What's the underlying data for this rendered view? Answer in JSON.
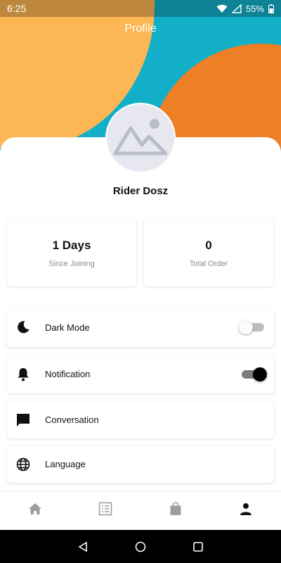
{
  "status_bar": {
    "time": "6:25",
    "battery": "55%",
    "icons": [
      "wifi-icon",
      "signal-icon",
      "battery-icon"
    ]
  },
  "header": {
    "title": "Profile"
  },
  "profile": {
    "avatar_icon": "image-placeholder-icon",
    "name": "Rider Dosz"
  },
  "stats": [
    {
      "value": "1 Days",
      "label": "Since Joining"
    },
    {
      "value": "0",
      "label": "Total Order"
    }
  ],
  "menu": {
    "items": [
      {
        "label": "Dark Mode",
        "icon": "moon-icon",
        "toggle": "off"
      },
      {
        "label": "Notification",
        "icon": "bell-icon",
        "toggle": "on"
      },
      {
        "label": "Conversation",
        "icon": "chat-icon"
      },
      {
        "label": "Language",
        "icon": "globe-icon"
      }
    ]
  },
  "bottom_nav": {
    "items": [
      {
        "icon": "home-icon",
        "active": false
      },
      {
        "icon": "list-icon",
        "active": false
      },
      {
        "icon": "shopping-bag-icon",
        "active": false
      },
      {
        "icon": "person-icon",
        "active": true
      }
    ]
  },
  "system_nav": {
    "items": [
      "back-icon",
      "home-circle-icon",
      "recents-icon"
    ]
  },
  "colors": {
    "cyan": "#13AFC8",
    "yellow": "#FCB653",
    "orange": "#EF7F27",
    "nav_inactive": "#9E9E9E",
    "nav_active": "#111111"
  }
}
